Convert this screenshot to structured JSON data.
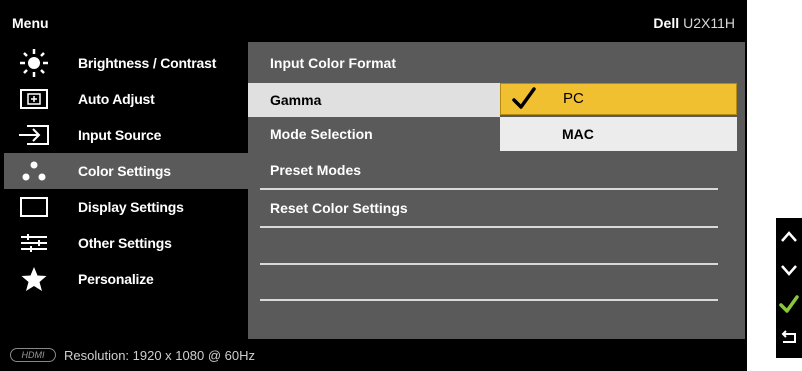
{
  "header": {
    "menu_label": "Menu",
    "brand": "Dell",
    "model": "U2X11H"
  },
  "sidebar": {
    "items": [
      {
        "label": "Brightness / Contrast",
        "icon": "brightness-icon",
        "active": false
      },
      {
        "label": "Auto Adjust",
        "icon": "auto-adjust-icon",
        "active": false
      },
      {
        "label": "Input Source",
        "icon": "input-source-icon",
        "active": false
      },
      {
        "label": "Color Settings",
        "icon": "color-settings-icon",
        "active": true
      },
      {
        "label": "Display Settings",
        "icon": "display-settings-icon",
        "active": false
      },
      {
        "label": "Other Settings",
        "icon": "other-settings-icon",
        "active": false
      },
      {
        "label": "Personalize",
        "icon": "star-icon",
        "active": false
      }
    ]
  },
  "submenu": {
    "items": [
      {
        "label": "Input Color Format"
      },
      {
        "label": "Gamma"
      },
      {
        "label": "Mode Selection"
      },
      {
        "label": "Preset Modes"
      },
      {
        "label": "Reset Color Settings"
      }
    ]
  },
  "options": {
    "selected": "PC",
    "other": "MAC"
  },
  "status": {
    "hdmi_label": "HDMI",
    "resolution": "Resolution: 1920 x 1080 @ 60Hz"
  },
  "nav_keys": [
    "up-arrow-icon",
    "down-arrow-icon",
    "check-icon",
    "back-icon"
  ],
  "colors": {
    "highlight": "#f0c030",
    "check_green": "#8cc63f",
    "panel_gray": "#5a5a5a"
  }
}
